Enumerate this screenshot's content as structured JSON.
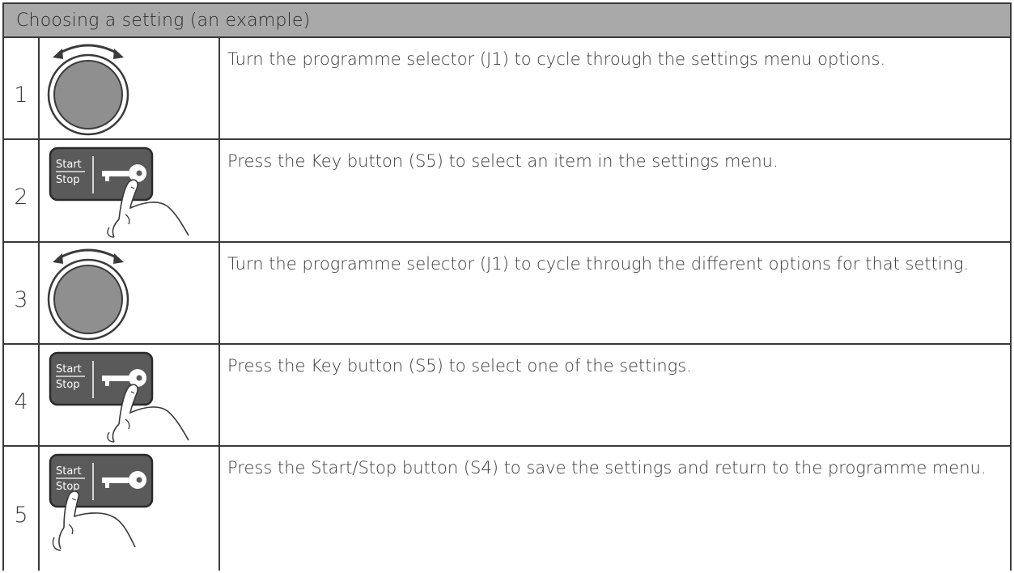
{
  "table": {
    "header": "Choosing a setting (an example)",
    "rows": [
      {
        "number": "1",
        "icon": "rotary-selector-icon",
        "text": "Turn the programme selector (J1) to cycle through the settings menu options."
      },
      {
        "number": "2",
        "icon": "key-button-press-icon",
        "text": "Press the Key button (S5) to select an item in the settings menu."
      },
      {
        "number": "3",
        "icon": "rotary-selector-icon",
        "text": "Turn the programme selector (J1) to cycle through the different options for that setting."
      },
      {
        "number": "4",
        "icon": "key-button-press-icon",
        "text": "Press the Key button (S5) to select one of the settings."
      },
      {
        "number": "5",
        "icon": "start-stop-button-press-icon",
        "text": "Press the Start/Stop button (S4) to save the settings and return to the programme menu."
      }
    ]
  },
  "button_labels": {
    "start": "Start",
    "stop": "Stop"
  },
  "colors": {
    "header_bg": "#a9a9a9",
    "dial_fill": "#8f8f8f",
    "button_fill": "#5a5a5a",
    "border": "#3a3a3a"
  }
}
